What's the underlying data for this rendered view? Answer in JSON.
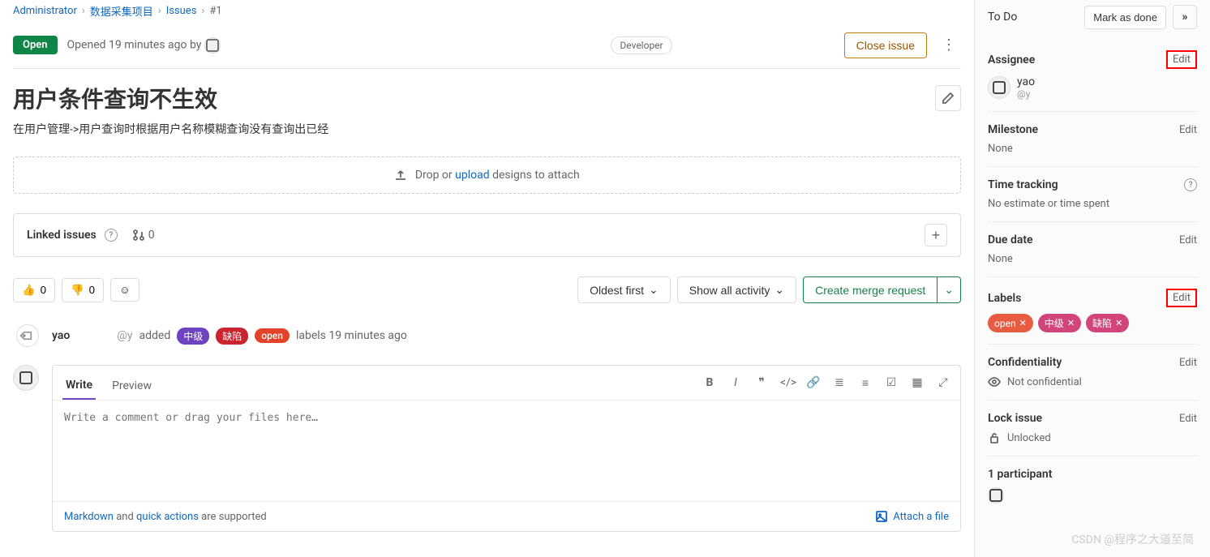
{
  "breadcrumbs": {
    "admin": "Administrator",
    "project": "数据采集项目",
    "issues": "Issues",
    "num": "#1"
  },
  "issue": {
    "status": "Open",
    "opened": "Opened 19 minutes ago by",
    "role": "Developer",
    "close_btn": "Close issue",
    "title": "用户条件查询不生效",
    "description": "在用户管理->用户查询时根据用户名称模糊查询没有查询出已经"
  },
  "upload": {
    "prefix": "Drop or ",
    "link": "upload",
    "suffix": " designs to attach"
  },
  "linked": {
    "title": "Linked issues",
    "count": "0"
  },
  "reactions": {
    "up": "0",
    "down": "0"
  },
  "filters": {
    "sort": "Oldest first",
    "activity": "Show all activity",
    "merge": "Create merge request"
  },
  "activity_entry": {
    "author": "yao",
    "handle": "@y",
    "action": "added",
    "labels": {
      "mid": "中级",
      "defect": "缺陷",
      "open": "open"
    },
    "suffix": "labels 19 minutes ago"
  },
  "editor": {
    "tab_write": "Write",
    "tab_preview": "Preview",
    "placeholder": "Write a comment or drag your files here…",
    "help_md": "Markdown",
    "help_and": " and ",
    "help_qa": "quick actions",
    "help_sfx": " are supported",
    "attach": "Attach a file"
  },
  "sidebar": {
    "todo": "To Do",
    "mark_done": "Mark as done",
    "assignee": {
      "title": "Assignee",
      "edit": "Edit",
      "name": "yao",
      "handle": "@y"
    },
    "milestone": {
      "title": "Milestone",
      "edit": "Edit",
      "value": "None"
    },
    "time": {
      "title": "Time tracking",
      "value": "No estimate or time spent"
    },
    "due": {
      "title": "Due date",
      "edit": "Edit",
      "value": "None"
    },
    "labels": {
      "title": "Labels",
      "edit": "Edit",
      "open": "open",
      "mid": "中级",
      "defect": "缺陷"
    },
    "conf": {
      "title": "Confidentiality",
      "edit": "Edit",
      "value": "Not confidential"
    },
    "lock": {
      "title": "Lock issue",
      "edit": "Edit",
      "value": "Unlocked"
    },
    "participants": "1 participant"
  },
  "watermark": "CSDN @程序之大道至简"
}
